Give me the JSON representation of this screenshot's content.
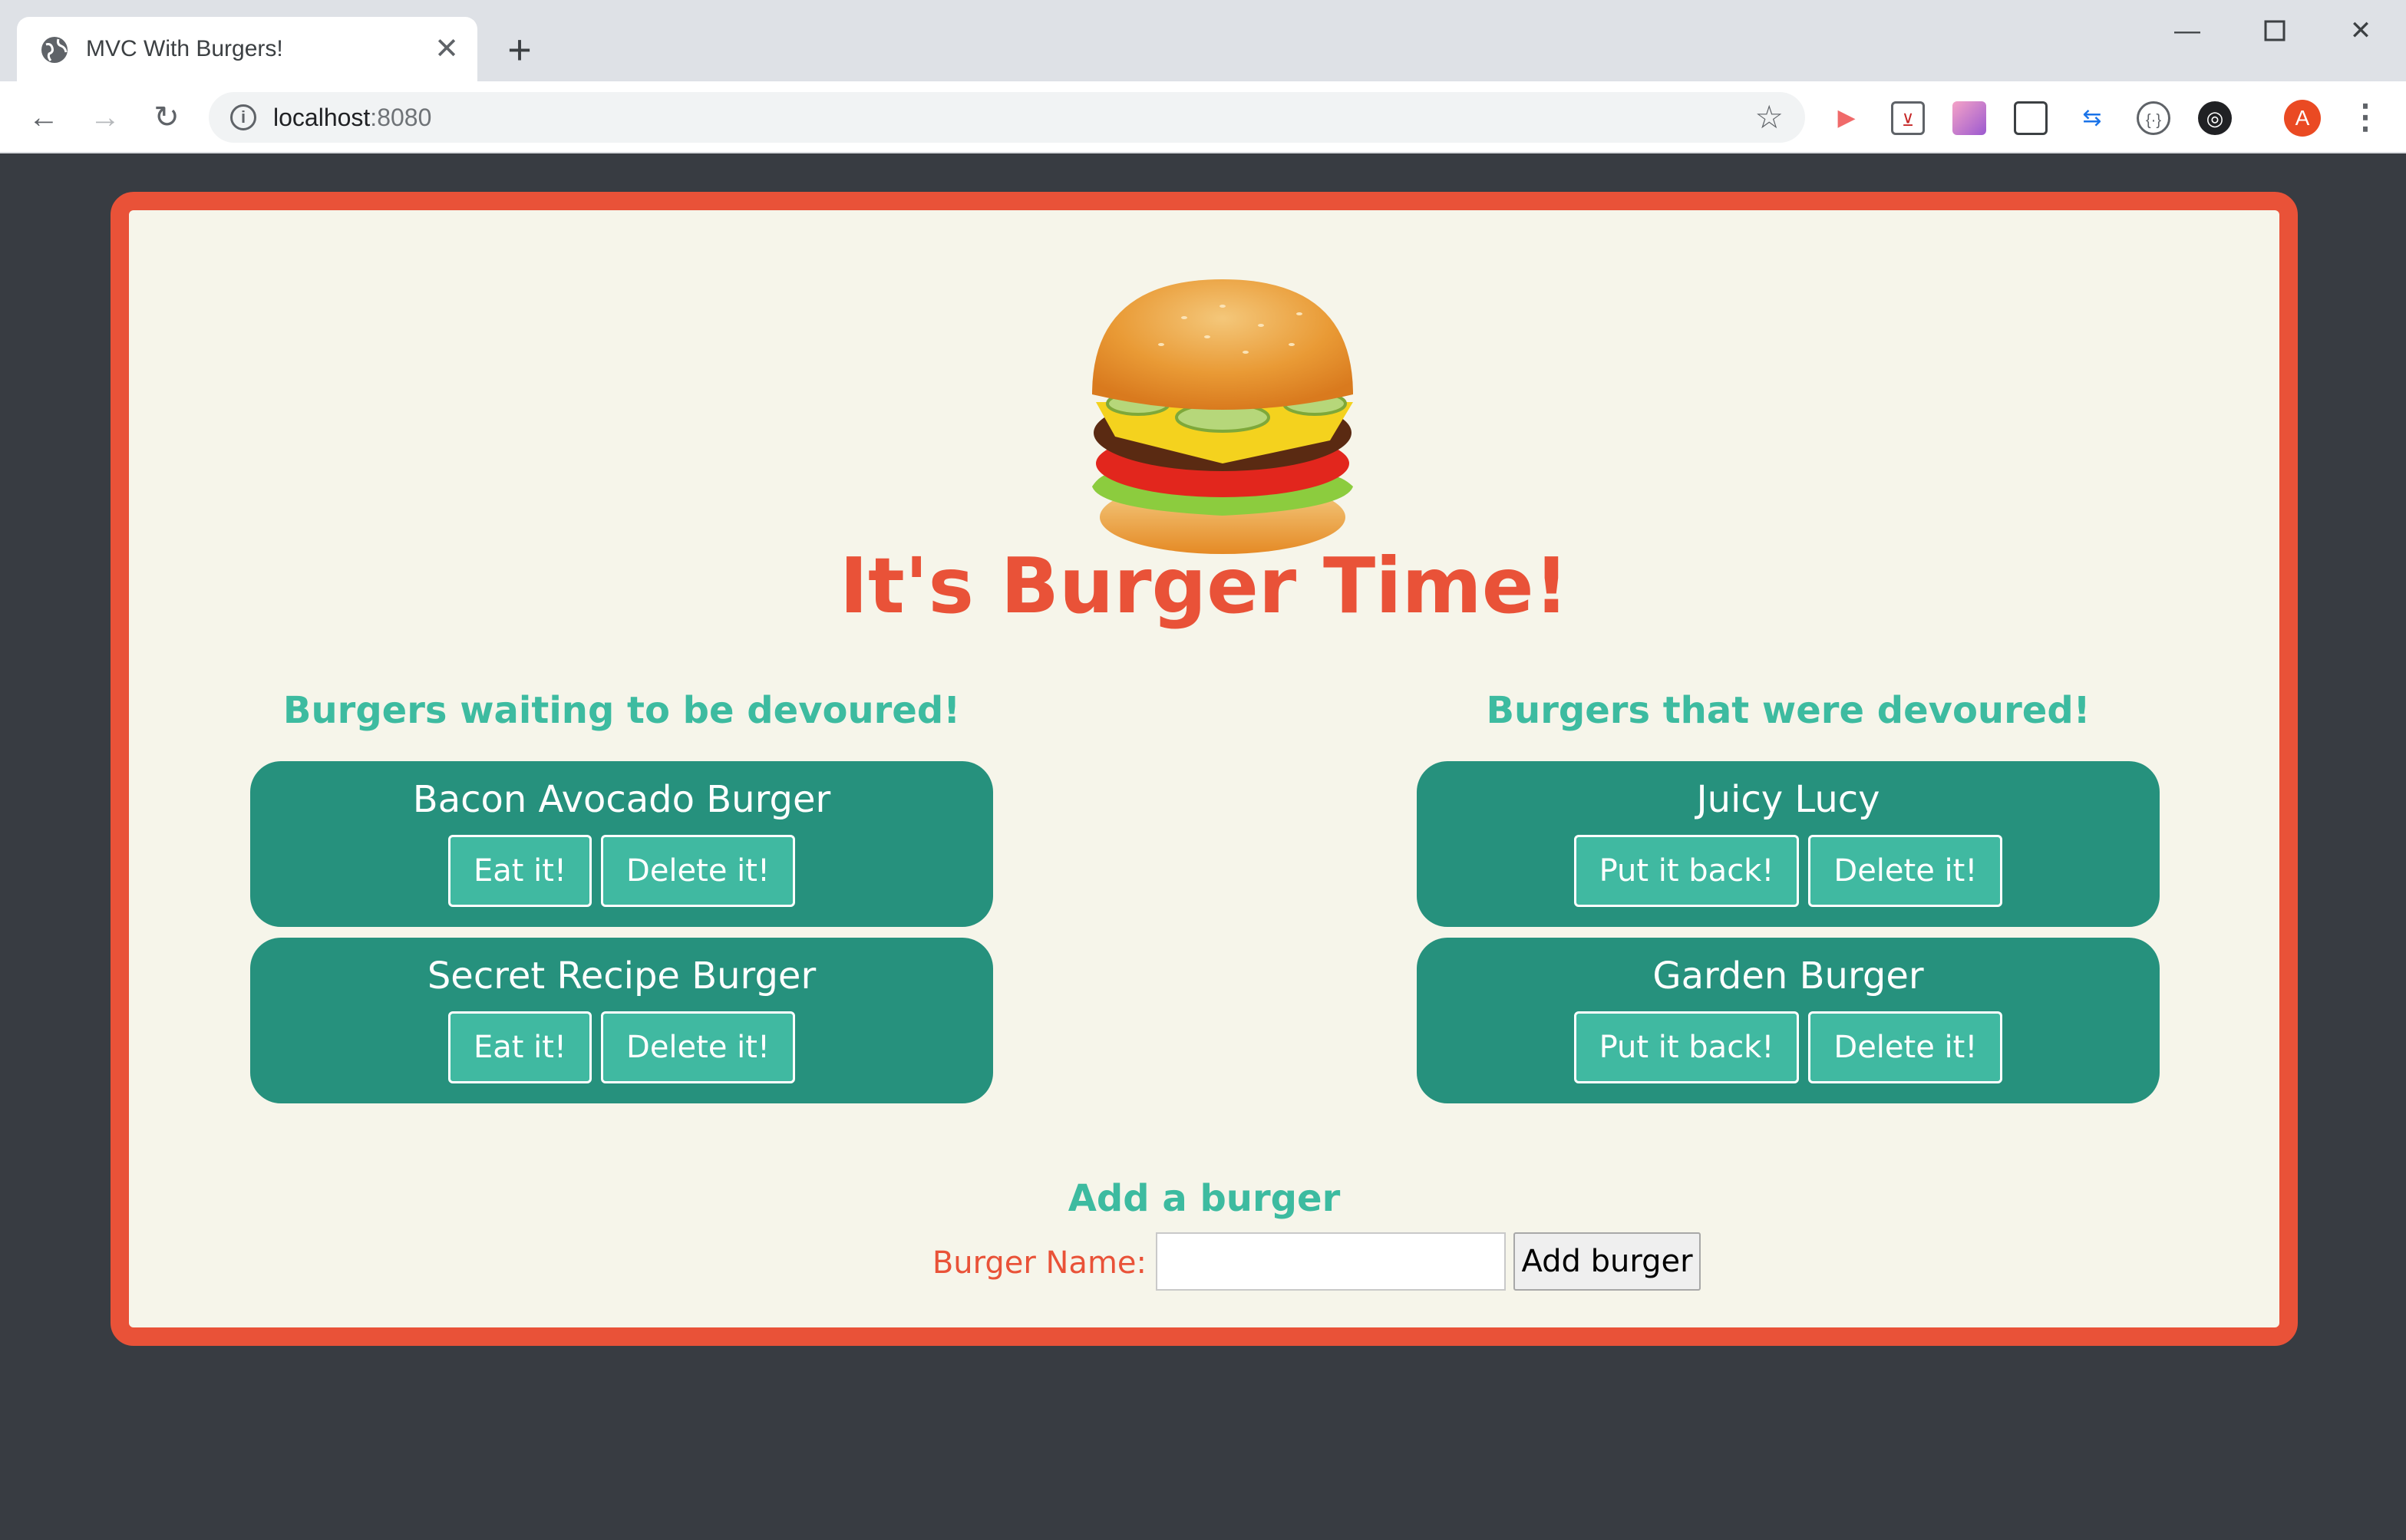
{
  "browser": {
    "tab_title": "MVC With Burgers!",
    "tab_close": "✕",
    "new_tab": "+",
    "url_host": "localhost",
    "url_port": ":8080",
    "avatar_letter": "A"
  },
  "page": {
    "title": "It's Burger Time!",
    "waiting_heading": "Burgers waiting to be devoured!",
    "devoured_heading": "Burgers that were devoured!",
    "waiting": [
      {
        "name": "Bacon Avocado Burger",
        "eat_label": "Eat it!",
        "delete_label": "Delete it!"
      },
      {
        "name": "Secret Recipe Burger",
        "eat_label": "Eat it!",
        "delete_label": "Delete it!"
      }
    ],
    "devoured": [
      {
        "name": "Juicy Lucy",
        "putback_label": "Put it back!",
        "delete_label": "Delete it!"
      },
      {
        "name": "Garden Burger",
        "putback_label": "Put it back!",
        "delete_label": "Delete it!"
      }
    ],
    "add_heading": "Add a burger",
    "add_label": "Burger Name:",
    "add_input_value": "",
    "add_button": "Add burger"
  },
  "colors": {
    "accent_red": "#e95238",
    "teal_card": "#26917d",
    "teal_button": "#40b9a1",
    "teal_text": "#3dbba0",
    "page_bg": "#f6f5ea",
    "outer_bg": "#383c42"
  },
  "icons": {
    "favicon": "globe-icon",
    "back": "arrow-left-icon",
    "forward": "arrow-right-icon",
    "reload": "reload-icon",
    "info": "info-icon",
    "bookmark": "star-icon",
    "menu": "kebab-menu-icon",
    "hero": "burger-icon"
  }
}
